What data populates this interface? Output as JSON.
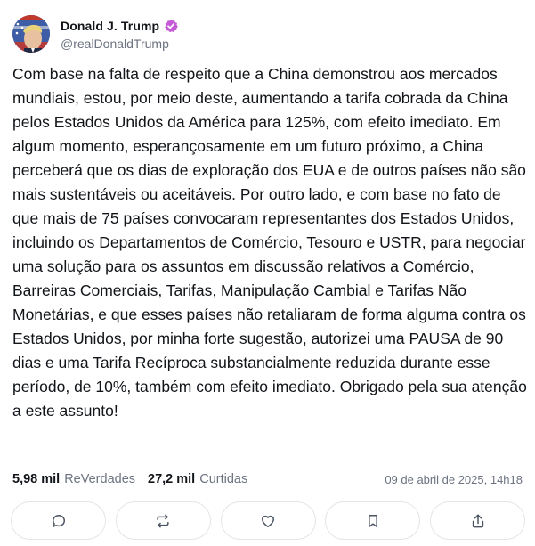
{
  "author": {
    "display_name": "Donald J. Trump",
    "handle": "@realDonaldTrump",
    "avatar_icon": "user-avatar",
    "verified_icon": "verified-badge-icon",
    "verified_color": "#c55cd6"
  },
  "post": {
    "text": "Com base na falta de respeito que a China demonstrou aos mercados mundiais, estou, por meio deste, aumentando a tarifa cobrada da China pelos Estados Unidos da América para 125%, com efeito imediato. Em algum momento, esperançosamente em um futuro próximo, a China perceberá que os dias de exploração dos EUA e de outros países não são mais sustentáveis ou aceitáveis. Por outro lado, e com base no fato de que mais de 75 países convocaram representantes dos Estados Unidos, incluindo os Departamentos de Comércio, Tesouro e USTR, para negociar uma solução para os assuntos em discussão relativos a Comércio, Barreiras Comerciais, Tarifas, Manipulação Cambial e Tarifas Não Monetárias, e que esses países não retaliaram de forma alguma contra os Estados Unidos, por minha forte sugestão, autorizei uma PAUSA de 90 dias e uma Tarifa Recíproca substancialmente reduzida durante esse período, de 10%, também com efeito imediato. Obrigado pela sua atenção a este assunto!"
  },
  "stats": {
    "reposts_count": "5,98 mil",
    "reposts_label": "ReVerdades",
    "likes_count": "27,2 mil",
    "likes_label": "Curtidas",
    "timestamp": "09 de abril de 2025, 14h18"
  },
  "actions": [
    {
      "icon": "reply-icon"
    },
    {
      "icon": "repost-icon"
    },
    {
      "icon": "like-icon"
    },
    {
      "icon": "bookmark-icon"
    },
    {
      "icon": "share-icon"
    }
  ],
  "colors": {
    "text": "#111418",
    "muted": "#6b7280",
    "border": "#e3e5e8"
  }
}
